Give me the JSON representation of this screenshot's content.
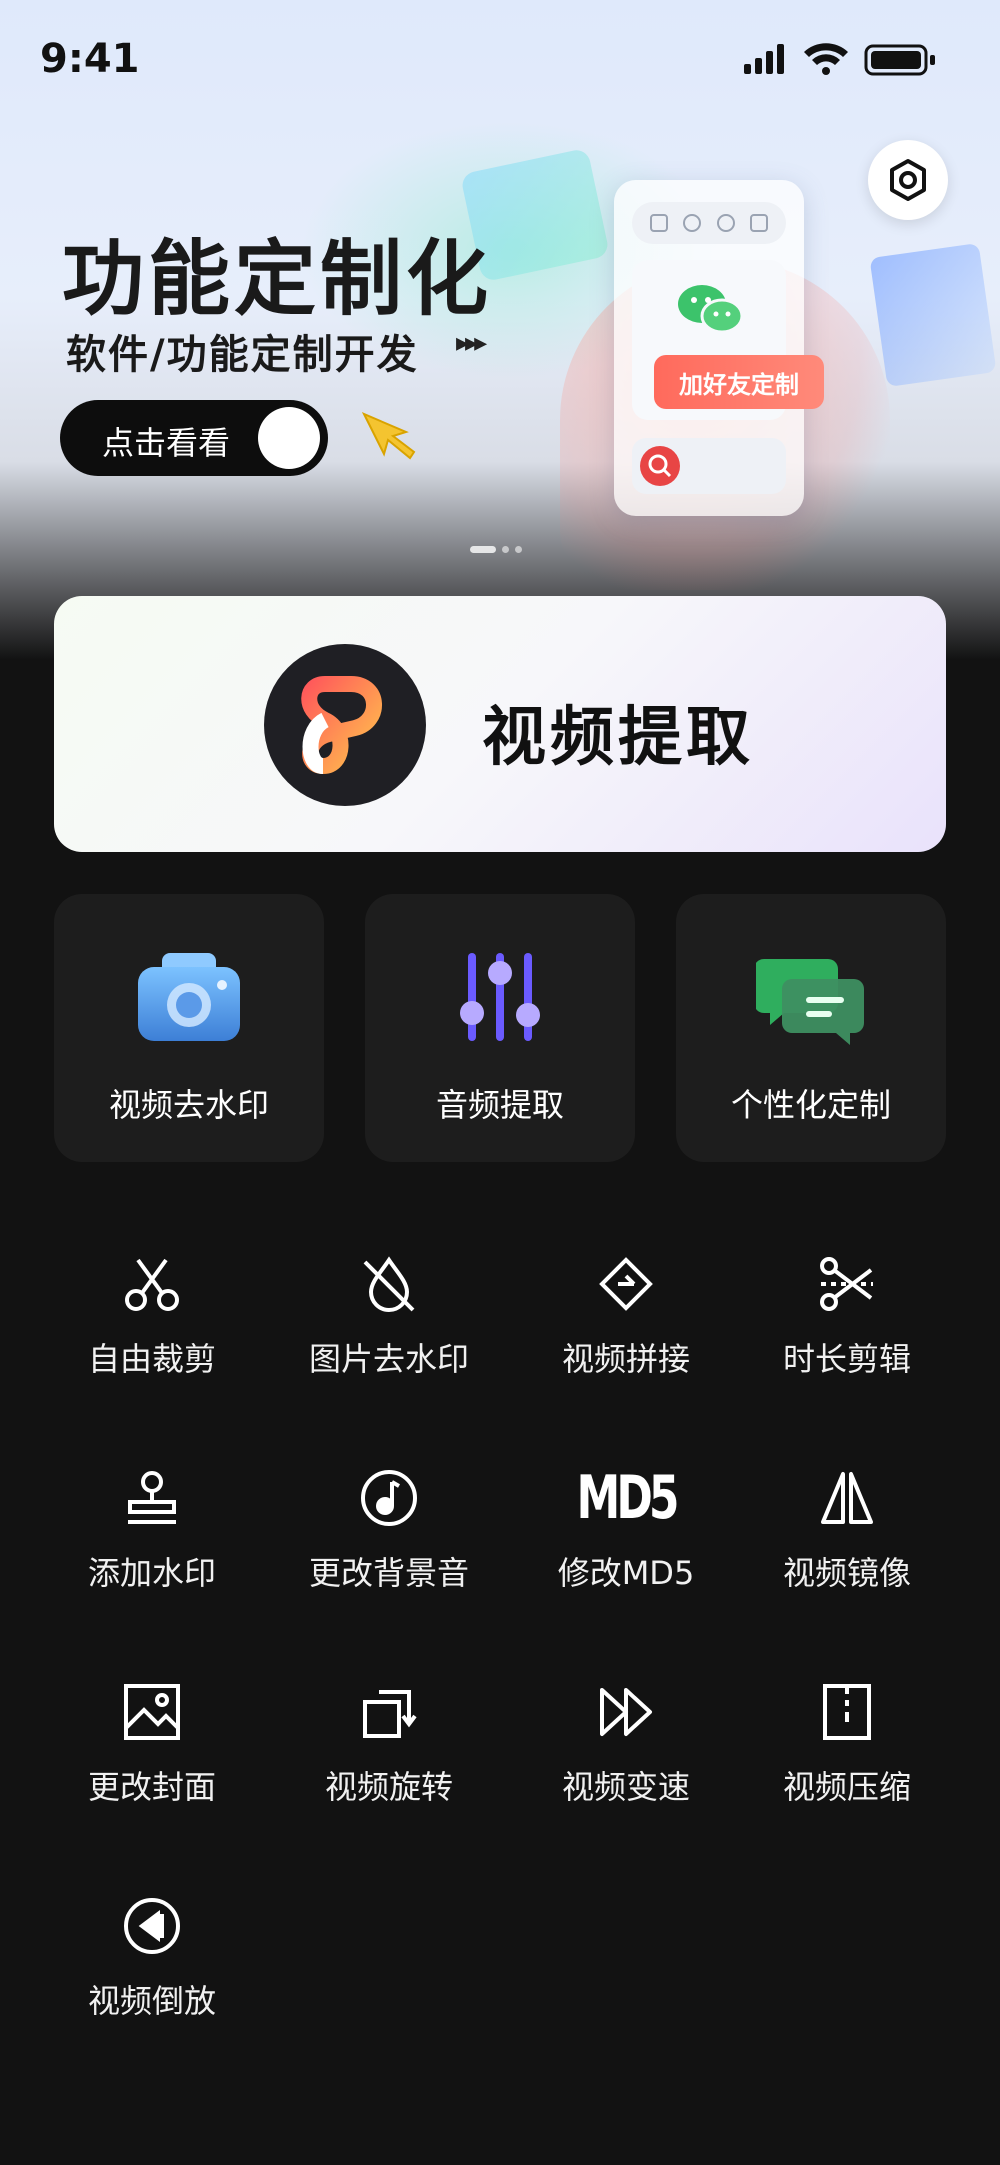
{
  "status_bar": {
    "time": "9:41"
  },
  "banner": {
    "title": "功能定制化",
    "subtitle": "软件/功能定制开发",
    "arrows": "▸▸▸",
    "toggle_label": "点击看看",
    "phone_tag": "加好友定制",
    "colors": {
      "accent": "#ff6a5c",
      "toggle_bg": "#0d0d0d"
    }
  },
  "main_card": {
    "title": "视频提取",
    "logo_icon": "d-logo-icon"
  },
  "features": [
    {
      "label": "视频去水印",
      "icon": "camera-icon"
    },
    {
      "label": "音频提取",
      "icon": "equalizer-icon"
    },
    {
      "label": "个性化定制",
      "icon": "chat-bubbles-icon"
    }
  ],
  "tools": [
    {
      "label": "自由裁剪",
      "icon": "scissors-icon"
    },
    {
      "label": "图片去水印",
      "icon": "no-drop-icon"
    },
    {
      "label": "视频拼接",
      "icon": "diamond-join-icon"
    },
    {
      "label": "时长剪辑",
      "icon": "dashed-scissors-icon"
    },
    {
      "label": "添加水印",
      "icon": "stamp-icon"
    },
    {
      "label": "更改背景音",
      "icon": "music-note-circle-icon"
    },
    {
      "label": "修改MD5",
      "icon": "md5-icon",
      "glyph": "MD5"
    },
    {
      "label": "视频镜像",
      "icon": "mirror-icon"
    },
    {
      "label": "更改封面",
      "icon": "image-icon"
    },
    {
      "label": "视频旋转",
      "icon": "rotate-icon"
    },
    {
      "label": "视频变速",
      "icon": "fast-forward-icon"
    },
    {
      "label": "视频压缩",
      "icon": "zip-icon"
    },
    {
      "label": "视频倒放",
      "icon": "rewind-circle-icon"
    }
  ]
}
